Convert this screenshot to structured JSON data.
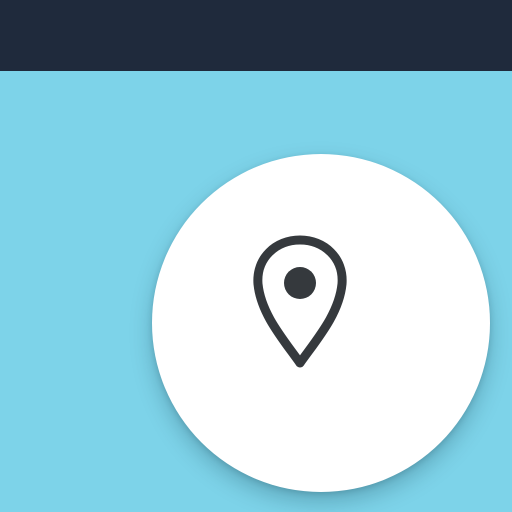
{
  "top_bar": {
    "color": "#1f2a3c"
  },
  "canvas": {
    "background_color": "#7dd3e9"
  },
  "location_button": {
    "background_color": "#ffffff",
    "icon": "map-pin-icon",
    "icon_color": "#35393d"
  }
}
